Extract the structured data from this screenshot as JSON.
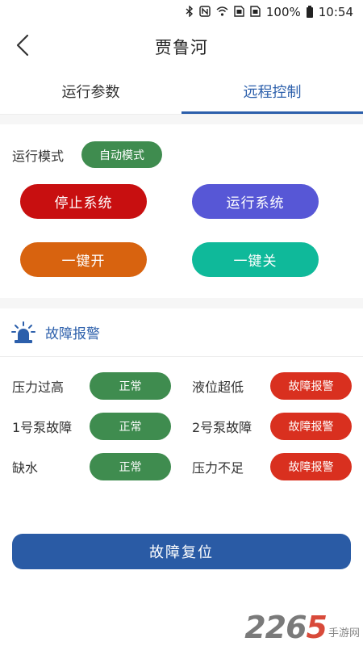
{
  "status_bar": {
    "icons": [
      "bluetooth-icon",
      "nfc-icon",
      "wifi-icon",
      "sim1-icon",
      "sim2-icon",
      "battery-icon"
    ],
    "battery": "100%",
    "time": "10:54"
  },
  "header": {
    "back_icon": "chevron-left-icon",
    "title": "贾鲁河"
  },
  "tabs": [
    {
      "label": "运行参数",
      "active": false
    },
    {
      "label": "远程控制",
      "active": true
    }
  ],
  "control": {
    "mode_label": "运行模式",
    "mode_value": "自动模式",
    "buttons": [
      {
        "label": "停止系统",
        "color": "#c80f10"
      },
      {
        "label": "运行系统",
        "color": "#5757d6"
      },
      {
        "label": "一键开",
        "color": "#d8630f"
      },
      {
        "label": "一键关",
        "color": "#0fb99a"
      }
    ]
  },
  "alarm": {
    "header_icon": "siren-icon",
    "title": "故障报警",
    "items": [
      {
        "label": "压力过高",
        "status": "正常",
        "ok": true
      },
      {
        "label": "液位超低",
        "status": "故障报警",
        "ok": false
      },
      {
        "label": "1号泵故障",
        "status": "正常",
        "ok": true
      },
      {
        "label": "2号泵故障",
        "status": "故障报警",
        "ok": false
      },
      {
        "label": "缺水",
        "status": "正常",
        "ok": true
      },
      {
        "label": "压力不足",
        "status": "故障报警",
        "ok": false
      }
    ],
    "reset_label": "故障复位"
  },
  "watermark": {
    "number_a": "22",
    "number_b": "6",
    "number_c": "5",
    "text": "手游网"
  },
  "colors": {
    "accent": "#2c5fab",
    "normal": "#3f8c4f",
    "fault": "#d9301f",
    "reset": "#2a5ba5"
  }
}
